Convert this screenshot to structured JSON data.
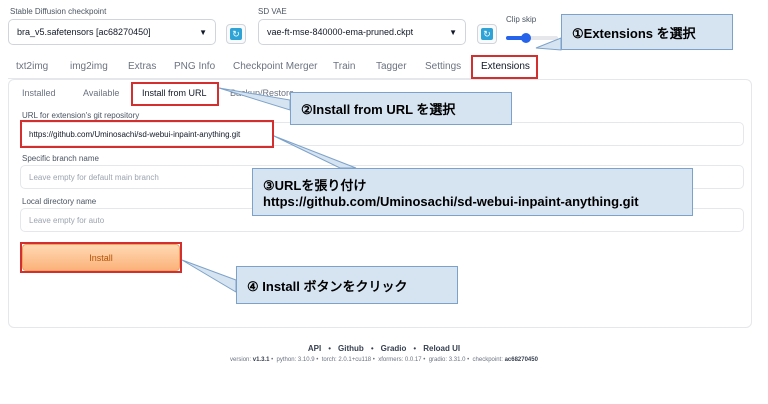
{
  "checkpoint": {
    "label": "Stable Diffusion checkpoint",
    "value": "bra_v5.safetensors [ac68270450]"
  },
  "vae": {
    "label": "SD VAE",
    "value": "vae-ft-mse-840000-ema-pruned.ckpt"
  },
  "clip_skip": {
    "label": "Clip skip"
  },
  "main_tabs": [
    "txt2img",
    "img2img",
    "Extras",
    "PNG Info",
    "Checkpoint Merger",
    "Train",
    "Tagger",
    "Settings",
    "Extensions"
  ],
  "sub_tabs": [
    "Installed",
    "Available",
    "Install from URL",
    "Backup/Restore"
  ],
  "form": {
    "url_label": "URL for extension's git repository",
    "url_value": "https://github.com/Uminosachi/sd-webui-inpaint-anything.git",
    "branch_label": "Specific branch name",
    "branch_placeholder": "Leave empty for default main branch",
    "dir_label": "Local directory name",
    "dir_placeholder": "Leave empty for auto",
    "install_label": "Install"
  },
  "callouts": {
    "step1": "①Extensions を選択",
    "step2": "②Install from URL を選択",
    "step3_line1": "③URLを張り付け",
    "step3_line2": "https://github.com/Uminosachi/sd-webui-inpaint-anything.git",
    "step4": "④ Install ボタンをクリック"
  },
  "footer": {
    "links": [
      "API",
      "Github",
      "Gradio",
      "Reload UI"
    ],
    "version": [
      {
        "k": "version: ",
        "v": "v1.3.1"
      },
      {
        "k": "python: ",
        "v": "3.10.9"
      },
      {
        "k": "torch: ",
        "v": "2.0.1+cu118"
      },
      {
        "k": "xformers: ",
        "v": "0.0.17"
      },
      {
        "k": "gradio: ",
        "v": "3.31.0"
      },
      {
        "k": "checkpoint: ",
        "v": "ac68270450"
      }
    ]
  },
  "colors": {
    "annotation_red": "#d32f2f",
    "callout_bg": "#d6e4f2",
    "accent_blue": "#2563eb"
  }
}
